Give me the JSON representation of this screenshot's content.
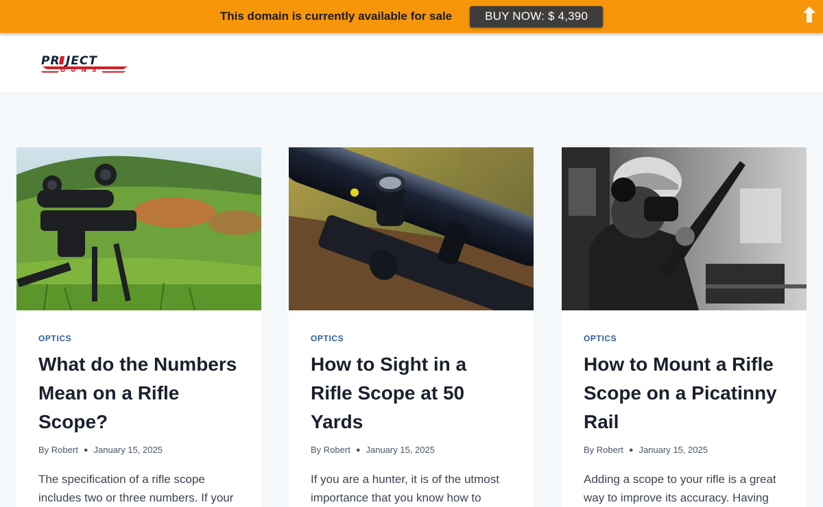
{
  "sale_bar": {
    "text": "This domain is currently available for sale",
    "button_label": "BUY NOW: $ 4,390",
    "color": "#f7960b"
  },
  "header": {
    "logo_text": "PROJECT GUNS"
  },
  "posts": [
    {
      "category": "OPTICS",
      "title": "What do the Numbers Mean on a Rifle Scope?",
      "author_prefix": "By",
      "author": "Robert",
      "date": "January 15, 2025",
      "excerpt": "The specification of a rifle scope includes two or three numbers. If your"
    },
    {
      "category": "OPTICS",
      "title": "How to Sight in a Rifle Scope at 50 Yards",
      "author_prefix": "By",
      "author": "Robert",
      "date": "January 15, 2025",
      "excerpt": "If you are a hunter, it is of the utmost importance that you know how to"
    },
    {
      "category": "OPTICS",
      "title": "How to Mount a Rifle Scope on a Picatinny Rail",
      "author_prefix": "By",
      "author": "Robert",
      "date": "January 15, 2025",
      "excerpt": "Adding a scope to your rifle is a great way to improve its accuracy. Having"
    }
  ]
}
